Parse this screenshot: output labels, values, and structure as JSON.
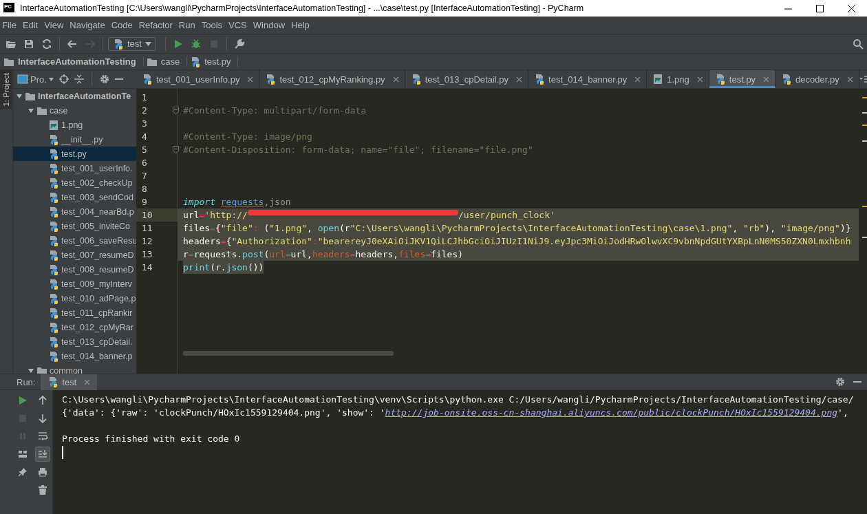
{
  "window": {
    "badge": "PC",
    "title": "InterfaceAutomationTesting [C:\\Users\\wangli\\PycharmProjects\\InterfaceAutomationTesting] - ...\\case\\test.py [InterfaceAutomationTesting] - PyCharm"
  },
  "menu": [
    "File",
    "Edit",
    "View",
    "Navigate",
    "Code",
    "Refactor",
    "Run",
    "Tools",
    "VCS",
    "Window",
    "Help"
  ],
  "toolbar": {
    "tools": [
      {
        "kind": "open",
        "disabled": false
      },
      {
        "kind": "save",
        "disabled": false
      },
      {
        "kind": "sync",
        "disabled": false
      },
      {
        "kind": "back",
        "disabled": false
      },
      {
        "kind": "forward",
        "disabled": true
      },
      {
        "kind": "config",
        "label": "test"
      },
      {
        "kind": "run",
        "disabled": false
      },
      {
        "kind": "debug",
        "disabled": false
      },
      {
        "kind": "stop",
        "disabled": true
      },
      {
        "kind": "wrench",
        "disabled": false
      }
    ]
  },
  "breadcrumb": [
    {
      "label": "InterfaceAutomationTesting",
      "kind": "project"
    },
    {
      "label": "case",
      "kind": "folder"
    },
    {
      "label": "test.py",
      "kind": "python"
    }
  ],
  "side_tab": {
    "label": "1: Project",
    "selected": true
  },
  "project_panel": {
    "title": "Pro.",
    "tree": [
      {
        "label": "InterfaceAutomationTe",
        "kind": "project",
        "expanded": true,
        "selected": false,
        "children": [
          {
            "label": "case",
            "kind": "folder",
            "expanded": true,
            "selected": false,
            "children": [
              {
                "label": "1.png",
                "kind": "image",
                "selected": false
              },
              {
                "label": "__init__.py",
                "kind": "python",
                "selected": false
              },
              {
                "label": "test.py",
                "kind": "python",
                "selected": true
              },
              {
                "label": "test_001_userInfo.",
                "kind": "python",
                "selected": false
              },
              {
                "label": "test_002_checkUp",
                "kind": "python",
                "selected": false
              },
              {
                "label": "test_003_sendCod",
                "kind": "python",
                "selected": false
              },
              {
                "label": "test_004_nearBd.p",
                "kind": "python",
                "selected": false
              },
              {
                "label": "test_005_inviteCo",
                "kind": "python",
                "selected": false
              },
              {
                "label": "test_006_saveResu",
                "kind": "python",
                "selected": false
              },
              {
                "label": "test_007_resumeD",
                "kind": "python",
                "selected": false
              },
              {
                "label": "test_008_resumeD",
                "kind": "python",
                "selected": false
              },
              {
                "label": "test_009_myInterv",
                "kind": "python",
                "selected": false
              },
              {
                "label": "test_010_adPage.p",
                "kind": "python",
                "selected": false
              },
              {
                "label": "test_011_cpRankir",
                "kind": "python",
                "selected": false
              },
              {
                "label": "test_012_cpMyRar",
                "kind": "python",
                "selected": false
              },
              {
                "label": "test_013_cpDetail.",
                "kind": "python",
                "selected": false
              },
              {
                "label": "test_014_banner.p",
                "kind": "python",
                "selected": false
              }
            ]
          },
          {
            "label": "common",
            "kind": "folder",
            "expanded": true,
            "selected": false
          }
        ]
      }
    ]
  },
  "editor": {
    "tabs": [
      {
        "label": "test_001_userInfo.py",
        "kind": "python",
        "selected": false
      },
      {
        "label": "test_012_cpMyRanking.py",
        "kind": "python",
        "selected": false
      },
      {
        "label": "test_013_cpDetail.py",
        "kind": "python",
        "selected": false
      },
      {
        "label": "test_014_banner.py",
        "kind": "python",
        "selected": false
      },
      {
        "label": "1.png",
        "kind": "image",
        "selected": false
      },
      {
        "label": "test.py",
        "kind": "python",
        "selected": true
      },
      {
        "label": "decoder.py",
        "kind": "python",
        "selected": false
      }
    ],
    "lines": [
      {
        "number": "1",
        "current": false,
        "selected": false,
        "fold": false
      },
      {
        "number": "2",
        "current": false,
        "selected": false,
        "fold": true,
        "tokens": [
          {
            "kind": "comment",
            "text": "#Content-Type: multipart/form-data"
          }
        ]
      },
      {
        "number": "3",
        "current": false,
        "selected": false,
        "fold": false
      },
      {
        "number": "4",
        "current": false,
        "selected": false,
        "fold": false,
        "tokens": [
          {
            "kind": "comment",
            "text": "#Content-Type: image/png"
          }
        ]
      },
      {
        "number": "5",
        "current": false,
        "selected": false,
        "fold": true,
        "tokens": [
          {
            "kind": "comment",
            "text": "#Content-Disposition: form-data; name=\"file\"; filename=\"file.png\""
          }
        ]
      },
      {
        "number": "6",
        "current": false,
        "selected": false,
        "fold": false
      },
      {
        "number": "7",
        "current": false,
        "selected": false,
        "fold": false
      },
      {
        "number": "8",
        "current": false,
        "selected": false,
        "fold": false
      },
      {
        "number": "9",
        "current": false,
        "selected": false,
        "fold": false,
        "tokens": [
          {
            "kind": "keyword",
            "text": "import"
          },
          {
            "kind": "module",
            "text": "requests"
          },
          {
            "kind": "unused",
            "text": ",json"
          }
        ]
      },
      {
        "number": "10",
        "current": true,
        "selected": true,
        "fold": false,
        "tokens": [
          {
            "kind": "plain",
            "text": "url"
          },
          {
            "kind": "op",
            "text": "="
          },
          {
            "kind": "string",
            "text": "'http://"
          },
          {
            "kind": "redacted"
          },
          {
            "kind": "string",
            "text": "/user/punch_clock'"
          }
        ]
      },
      {
        "number": "11",
        "current": false,
        "selected": true,
        "fold": false,
        "tokens": [
          {
            "kind": "plain",
            "text": "files"
          },
          {
            "kind": "op",
            "text": "="
          },
          {
            "kind": "plain",
            "text": "{"
          },
          {
            "kind": "string",
            "text": "\"file\""
          },
          {
            "kind": "op",
            "text": ":"
          },
          {
            "kind": "plain",
            "text": " ("
          },
          {
            "kind": "string",
            "text": "\"1.png\""
          },
          {
            "kind": "plain",
            "text": ", "
          },
          {
            "kind": "builtin",
            "text": "open"
          },
          {
            "kind": "plain",
            "text": "(r"
          },
          {
            "kind": "string",
            "text": "\"C:\\Users\\wangli\\PycharmProjects\\InterfaceAutomationTesting\\case\\1.png\""
          },
          {
            "kind": "plain",
            "text": ", "
          },
          {
            "kind": "string",
            "text": "\"rb\""
          },
          {
            "kind": "plain",
            "text": "), "
          },
          {
            "kind": "string",
            "text": "\"image/png\""
          },
          {
            "kind": "plain",
            "text": ")}"
          }
        ]
      },
      {
        "number": "12",
        "current": false,
        "selected": true,
        "fold": false,
        "tokens": [
          {
            "kind": "plain",
            "text": "headers"
          },
          {
            "kind": "op",
            "text": "="
          },
          {
            "kind": "plain",
            "text": "{"
          },
          {
            "kind": "string",
            "text": "\"Authorization\""
          },
          {
            "kind": "op",
            "text": ":"
          },
          {
            "kind": "string",
            "text": "\"bearereyJ0eXAiOiJKV1QiLCJhbGciOiJIUzI1NiJ9.eyJpc3MiOiJodHRwOlwvXC9vbnNpdGUtYXBpLnN0MS50ZXN0Lmxhbnh"
          }
        ]
      },
      {
        "number": "13",
        "current": false,
        "selected": true,
        "fold": false,
        "tokens": [
          {
            "kind": "plain",
            "text": "r"
          },
          {
            "kind": "op",
            "text": "="
          },
          {
            "kind": "plain",
            "text": "requests."
          },
          {
            "kind": "builtin",
            "text": "post"
          },
          {
            "kind": "plain",
            "text": "("
          },
          {
            "kind": "param",
            "text": "url"
          },
          {
            "kind": "op",
            "text": "="
          },
          {
            "kind": "plain",
            "text": "url,"
          },
          {
            "kind": "param",
            "text": "headers"
          },
          {
            "kind": "op",
            "text": "="
          },
          {
            "kind": "plain",
            "text": "headers,"
          },
          {
            "kind": "param",
            "text": "files"
          },
          {
            "kind": "op",
            "text": "="
          },
          {
            "kind": "plain",
            "text": "files)"
          }
        ]
      },
      {
        "number": "14",
        "current": false,
        "selected": true,
        "fold": false,
        "tokens": [
          {
            "kind": "builtin",
            "text": "print"
          },
          {
            "kind": "plain",
            "text": "(r."
          },
          {
            "kind": "builtin",
            "text": "json"
          },
          {
            "kind": "plain",
            "text": "())"
          }
        ]
      }
    ]
  },
  "run_panel": {
    "label": "Run:",
    "tab": "test",
    "tool_columns": [
      [
        {
          "kind": "run",
          "disabled": false,
          "on": false
        },
        {
          "kind": "stop",
          "disabled": true,
          "on": false
        },
        {
          "kind": "pause",
          "disabled": true,
          "on": false
        },
        {
          "kind": "layout",
          "disabled": false,
          "on": false
        },
        {
          "kind": "pin",
          "disabled": false,
          "on": false
        }
      ],
      [
        {
          "kind": "up",
          "disabled": false,
          "on": false
        },
        {
          "kind": "down",
          "disabled": false,
          "on": false
        },
        {
          "kind": "wrap",
          "disabled": false,
          "on": false
        },
        {
          "kind": "scroll-end",
          "disabled": false,
          "on": true
        },
        {
          "kind": "print",
          "disabled": false,
          "on": false
        },
        {
          "kind": "trash",
          "disabled": false,
          "on": false
        }
      ]
    ],
    "output": [
      {
        "kind": "line",
        "segments": [
          {
            "kind": "plain",
            "text": "C:\\Users\\wangli\\PycharmProjects\\InterfaceAutomationTesting\\venv\\Scripts\\python.exe C:/Users/wangli/PycharmProjects/InterfaceAutomationTesting/case/"
          }
        ]
      },
      {
        "kind": "line",
        "segments": [
          {
            "kind": "plain",
            "text": "{'data': {'raw': 'clockPunch/HOxIc1559129404.png', 'show': '"
          },
          {
            "kind": "link",
            "text": "http://job-onsite.oss-cn-shanghai.aliyuncs.com/public/clockPunch/HOxIc1559129404.png"
          },
          {
            "kind": "plain",
            "text": "',"
          }
        ]
      },
      {
        "kind": "status",
        "segments": [
          {
            "kind": "plain",
            "text": "Process finished with exit code 0"
          }
        ]
      }
    ]
  }
}
